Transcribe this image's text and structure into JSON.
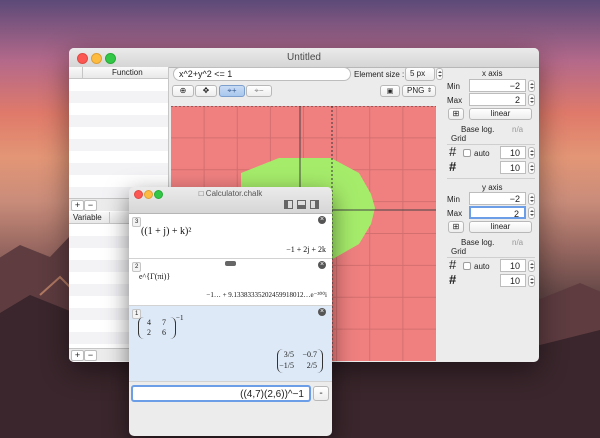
{
  "window": {
    "title": "Untitled"
  },
  "sidebar": {
    "function_header": "Function",
    "variable_header": "Variable",
    "add_label": "+",
    "remove_label": "−"
  },
  "toolbar": {
    "formula": "x^2+y^2 <= 1",
    "element_size_label": "Element size :",
    "element_size_value": "5 px",
    "export_format": "PNG"
  },
  "x_axis": {
    "title": "x axis",
    "min_label": "Min",
    "min_value": "−2",
    "max_label": "Max",
    "max_value": "2",
    "scale": "linear",
    "base_log_label": "Base log.",
    "base_log_value": "n/a",
    "grid_label": "Grid",
    "auto_label": "auto",
    "grid_major": "10",
    "grid_minor": "10"
  },
  "y_axis": {
    "title": "y axis",
    "min_label": "Min",
    "min_value": "−2",
    "max_label": "Max",
    "max_value": "2",
    "scale": "linear",
    "base_log_label": "Base log.",
    "base_log_value": "n/a",
    "grid_label": "Grid",
    "auto_label": "auto",
    "grid_major": "10",
    "grid_minor": "10"
  },
  "colors": {
    "outside": "#f08080",
    "inside": "#a6ec6b",
    "grid": "#d46f6f",
    "axis": "#444444"
  },
  "calculator": {
    "title": "Calculator.chalk",
    "entries": [
      {
        "index": "3",
        "input": "((1 + j) + k)²",
        "output": "−1 + 2j + 2k"
      },
      {
        "index": "2",
        "input": "e^{Γ(πi)}",
        "output": "−1… + 9.13383335202459918012…e⁻³⁰⁰i"
      },
      {
        "index": "1",
        "input_matrix": [
          "4",
          "7",
          "2",
          "6"
        ],
        "input_exp": "−1",
        "output_matrix": [
          "3/5",
          "−0.7",
          "−1/5",
          "2/5"
        ]
      }
    ],
    "input_value": "((4,7)(2,6))^−1",
    "minus_label": "-"
  }
}
